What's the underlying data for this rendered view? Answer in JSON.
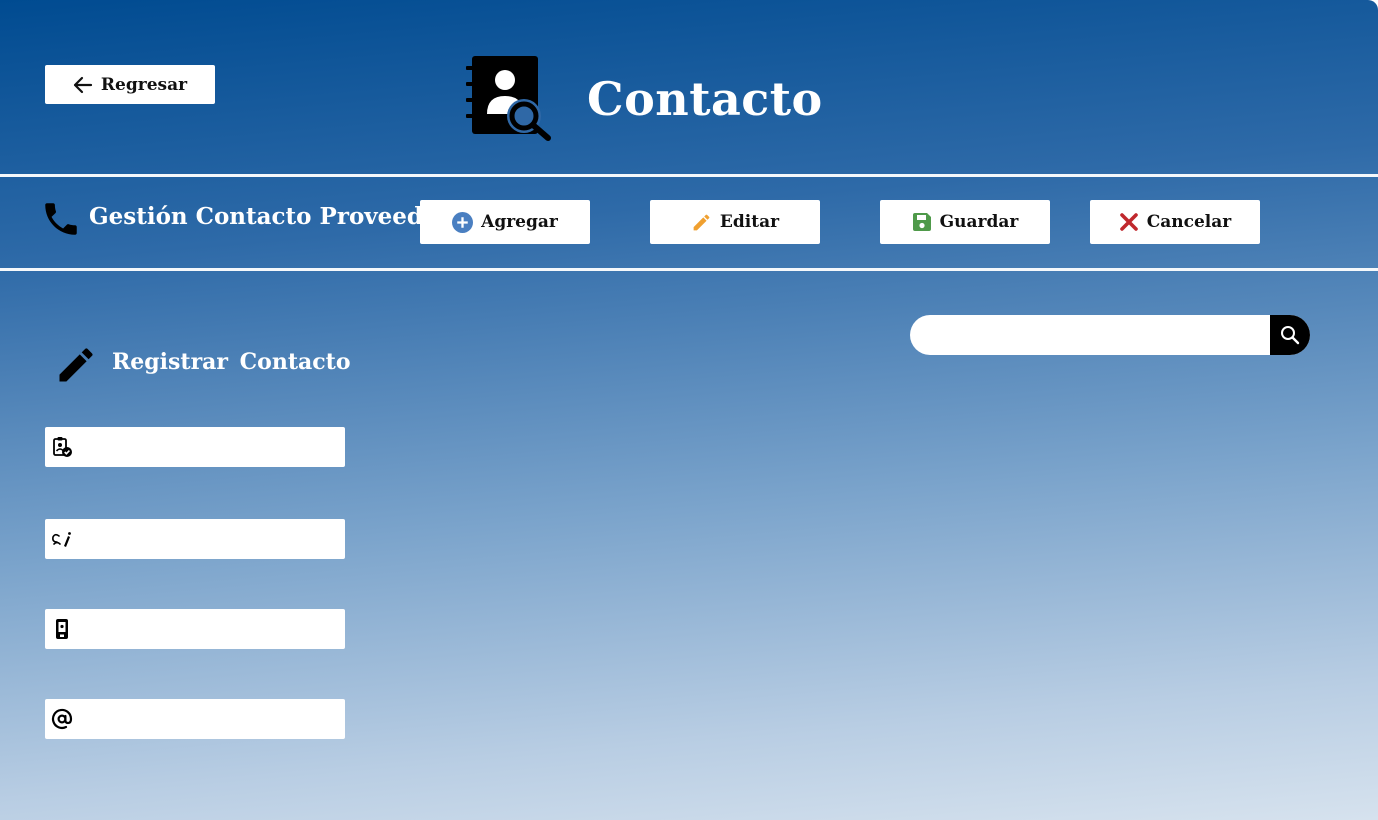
{
  "header": {
    "back_label": "Regresar",
    "title": "Contacto"
  },
  "toolbar": {
    "section_title": "Gestión Contacto Proveedor",
    "add_label": "Agregar",
    "edit_label": "Editar",
    "save_label": "Guardar",
    "cancel_label": "Cancelar"
  },
  "search": {
    "value": "",
    "placeholder": ""
  },
  "form": {
    "title": "Registrar Contacto",
    "fields": [
      {
        "icon": "id-check-icon",
        "value": "",
        "placeholder": ""
      },
      {
        "icon": "signature-icon",
        "value": "",
        "placeholder": ""
      },
      {
        "icon": "mobile-phone-icon",
        "value": "",
        "placeholder": ""
      },
      {
        "icon": "at-sign-icon",
        "value": "",
        "placeholder": ""
      }
    ]
  },
  "colors": {
    "header_gradient_top": "#004b91",
    "gradient_bottom": "#d6e2ee",
    "add_icon": "#4a7fc1",
    "edit_icon": "#f0a030",
    "save_icon": "#4f9a4a",
    "cancel_icon": "#c0282d"
  }
}
